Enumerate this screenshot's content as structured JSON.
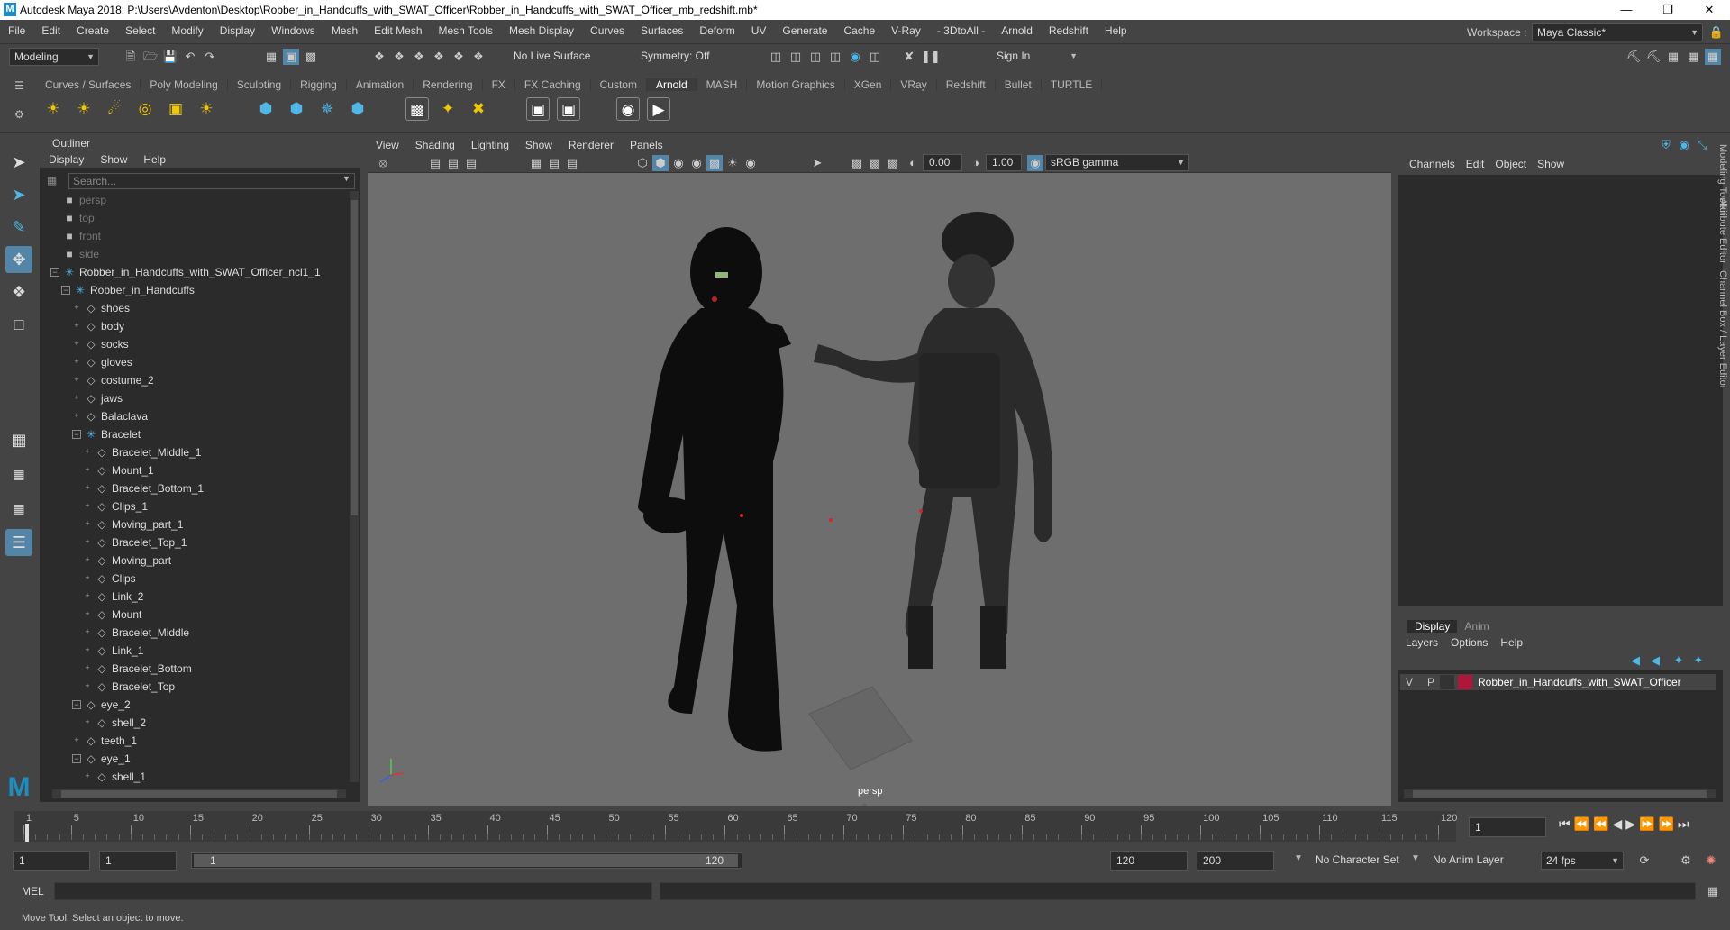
{
  "title": "Autodesk Maya 2018: P:\\Users\\Avdenton\\Desktop\\Robber_in_Handcuffs_with_SWAT_Officer\\Robber_in_Handcuffs_with_SWAT_Officer_mb_redshift.mb*",
  "menubar": [
    "File",
    "Edit",
    "Create",
    "Select",
    "Modify",
    "Display",
    "Windows",
    "Mesh",
    "Edit Mesh",
    "Mesh Tools",
    "Mesh Display",
    "Curves",
    "Surfaces",
    "Deform",
    "UV",
    "Generate",
    "Cache",
    "V-Ray",
    "- 3DtoAll -",
    "Arnold",
    "Redshift",
    "Help"
  ],
  "workspace_label": "Workspace :",
  "workspace_value": "Maya Classic*",
  "statusline": {
    "mode": "Modeling",
    "live_surface": "No Live Surface",
    "symmetry": "Symmetry: Off",
    "sign_in": "Sign In"
  },
  "shelf_tabs": [
    "Curves / Surfaces",
    "Poly Modeling",
    "Sculpting",
    "Rigging",
    "Animation",
    "Rendering",
    "FX",
    "FX Caching",
    "Custom",
    "Arnold",
    "MASH",
    "Motion Graphics",
    "XGen",
    "VRay",
    "Redshift",
    "Bullet",
    "TURTLE"
  ],
  "active_shelf": "Arnold",
  "outliner": {
    "title": "Outliner",
    "menu": [
      "Display",
      "Show",
      "Help"
    ],
    "search_placeholder": "Search...",
    "items": [
      {
        "label": "persp",
        "depth": 0,
        "kind": "camera"
      },
      {
        "label": "top",
        "depth": 0,
        "kind": "camera"
      },
      {
        "label": "front",
        "depth": 0,
        "kind": "camera"
      },
      {
        "label": "side",
        "depth": 0,
        "kind": "camera"
      },
      {
        "label": "Robber_in_Handcuffs_with_SWAT_Officer_ncl1_1",
        "depth": 0,
        "kind": "group",
        "expanded": true
      },
      {
        "label": "Robber_in_Handcuffs",
        "depth": 1,
        "kind": "group",
        "expanded": true
      },
      {
        "label": "shoes",
        "depth": 2,
        "kind": "mesh"
      },
      {
        "label": "body",
        "depth": 2,
        "kind": "mesh"
      },
      {
        "label": "socks",
        "depth": 2,
        "kind": "mesh"
      },
      {
        "label": "gloves",
        "depth": 2,
        "kind": "mesh"
      },
      {
        "label": "costume_2",
        "depth": 2,
        "kind": "mesh"
      },
      {
        "label": "jaws",
        "depth": 2,
        "kind": "mesh"
      },
      {
        "label": "Balaclava",
        "depth": 2,
        "kind": "mesh"
      },
      {
        "label": "Bracelet",
        "depth": 2,
        "kind": "group",
        "expanded": true
      },
      {
        "label": "Bracelet_Middle_1",
        "depth": 3,
        "kind": "mesh"
      },
      {
        "label": "Mount_1",
        "depth": 3,
        "kind": "mesh"
      },
      {
        "label": "Bracelet_Bottom_1",
        "depth": 3,
        "kind": "mesh"
      },
      {
        "label": "Clips_1",
        "depth": 3,
        "kind": "mesh"
      },
      {
        "label": "Moving_part_1",
        "depth": 3,
        "kind": "mesh"
      },
      {
        "label": "Bracelet_Top_1",
        "depth": 3,
        "kind": "mesh"
      },
      {
        "label": "Moving_part",
        "depth": 3,
        "kind": "mesh"
      },
      {
        "label": "Clips",
        "depth": 3,
        "kind": "mesh"
      },
      {
        "label": "Link_2",
        "depth": 3,
        "kind": "mesh"
      },
      {
        "label": "Mount",
        "depth": 3,
        "kind": "mesh"
      },
      {
        "label": "Bracelet_Middle",
        "depth": 3,
        "kind": "mesh"
      },
      {
        "label": "Link_1",
        "depth": 3,
        "kind": "mesh"
      },
      {
        "label": "Bracelet_Bottom",
        "depth": 3,
        "kind": "mesh"
      },
      {
        "label": "Bracelet_Top",
        "depth": 3,
        "kind": "mesh"
      },
      {
        "label": "eye_2",
        "depth": 2,
        "kind": "mesh",
        "expanded": true
      },
      {
        "label": "shell_2",
        "depth": 3,
        "kind": "mesh"
      },
      {
        "label": "teeth_1",
        "depth": 2,
        "kind": "mesh"
      },
      {
        "label": "eye_1",
        "depth": 2,
        "kind": "mesh",
        "expanded": true
      },
      {
        "label": "shell_1",
        "depth": 3,
        "kind": "mesh"
      }
    ]
  },
  "viewport": {
    "menu": [
      "View",
      "Shading",
      "Lighting",
      "Show",
      "Renderer",
      "Panels"
    ],
    "exposure": "0.00",
    "gamma": "1.00",
    "color_space": "sRGB gamma",
    "camera_label": "persp"
  },
  "channel_box": {
    "menu": [
      "Channels",
      "Edit",
      "Object",
      "Show"
    ],
    "side_tabs": [
      "Modeling Toolkit",
      "Attribute Editor",
      "Channel Box / Layer Editor"
    ]
  },
  "layer_editor": {
    "tabs": [
      "Display",
      "Anim"
    ],
    "active_tab": "Display",
    "menu": [
      "Layers",
      "Options",
      "Help"
    ],
    "layers": [
      {
        "v": "V",
        "p": "P",
        "color": "#b0163a",
        "name": "Robber_in_Handcuffs_with_SWAT_Officer"
      }
    ]
  },
  "timeline": {
    "ticks": [
      "1",
      "5",
      "10",
      "15",
      "20",
      "25",
      "30",
      "35",
      "40",
      "45",
      "50",
      "55",
      "60",
      "65",
      "70",
      "75",
      "80",
      "85",
      "90",
      "95",
      "100",
      "105",
      "110",
      "115",
      "120"
    ],
    "current_frame": "1"
  },
  "range": {
    "start": "1",
    "anim_start": "1",
    "range_start": "1",
    "range_end": "120",
    "anim_end_1": "120",
    "anim_end_2": "200",
    "character_set": "No Character Set",
    "anim_layer": "No Anim Layer",
    "fps": "24 fps"
  },
  "command": {
    "label": "MEL"
  },
  "help_line": "Move Tool: Select an object to move."
}
